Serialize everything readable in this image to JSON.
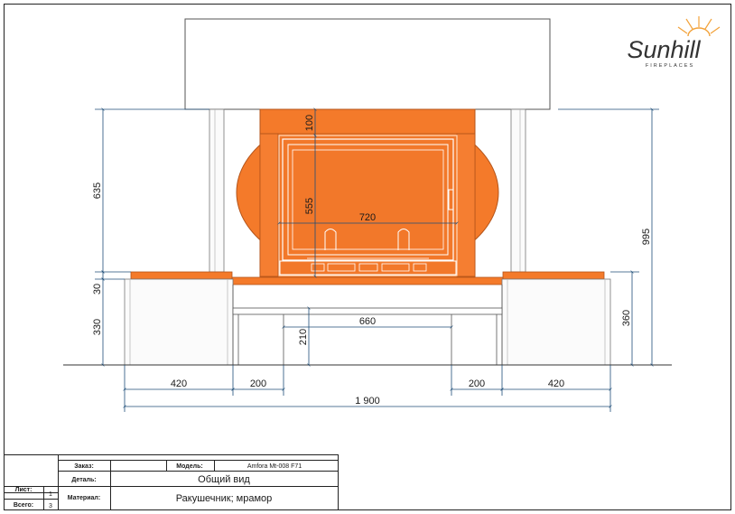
{
  "brand": {
    "name": "Sunhill",
    "subtitle": "FIREPLACES"
  },
  "colors": {
    "stone": "#f47a2a",
    "stone_light": "#f68c43",
    "dim_line": "#1f4e79",
    "outline": "#444444"
  },
  "dimensions": {
    "d100": "100",
    "d555": "555",
    "d720": "720",
    "d635": "635",
    "d995": "995",
    "d30": "30",
    "d330": "330",
    "d660": "660",
    "d210": "210",
    "d360": "360",
    "d420_left": "420",
    "d200_left": "200",
    "d200_right": "200",
    "d420_right": "420",
    "d1900": "1 900"
  },
  "title_block": {
    "order_label": "Заказ:",
    "order_value": "",
    "model_label": "Модель:",
    "model_value": "Amfora Mt-008 F71",
    "part_label": "Деталь:",
    "part_value": "Общий вид",
    "sheet_label": "Лист:",
    "sheet_value": "1",
    "total_label": "Всего:",
    "total_value": "3",
    "material_label": "Материал:",
    "material_value": "Ракушечник; мрамор"
  }
}
